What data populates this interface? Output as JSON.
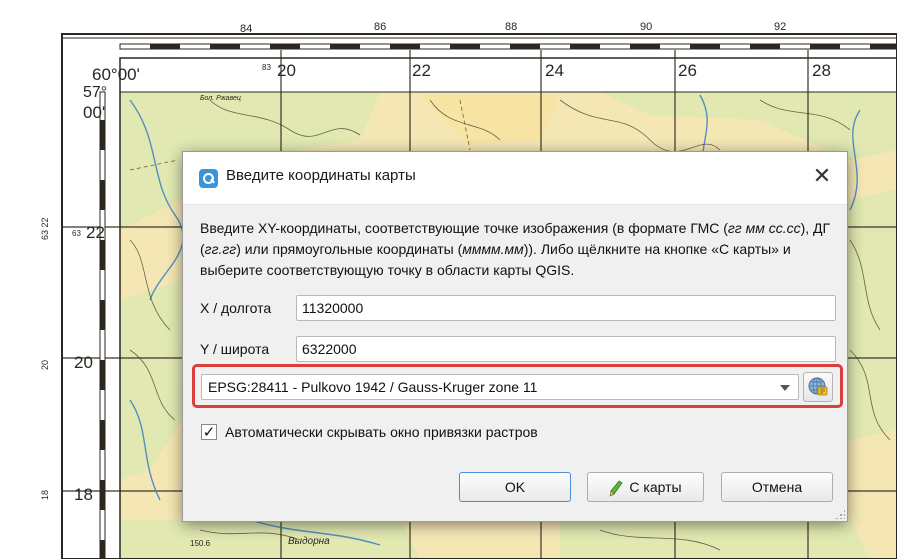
{
  "map": {
    "top_ticks": [
      "84",
      "86",
      "88",
      "90",
      "92"
    ],
    "inner_ticks": [
      "20",
      "22",
      "24",
      "26",
      "28"
    ],
    "corner_lon": "60°00'",
    "corner_lat_deg": "57°",
    "corner_lat_min": "00'",
    "small_prefix_top": "83",
    "small_prefix_left": "63",
    "left_side_label": "63 22",
    "left_marks": [
      "22",
      "20",
      "18"
    ],
    "left_margin_marks": [
      "20",
      "18"
    ],
    "place_label": "Бол. Ржавец",
    "bottom_place": "Выдорна",
    "bottom_number": "150.6"
  },
  "dialog": {
    "title": "Введите координаты карты",
    "description": {
      "p1": "Введите XY-координаты, соответствующие точке изображения (в формате ГМС (",
      "i1": "гг мм сс.сс",
      "p2": "), ДГ (",
      "i2": "гг.гг",
      "p3": ") или прямоугольные координаты (",
      "i3": "мммм.мм",
      "p4": ")). Либо щёлкните на кнопке «С карты» и выберите соответствующую точку в области карты QGIS."
    },
    "x_label": "X / долгота",
    "x_value": "11320000",
    "y_label": "Y / широта",
    "y_value": "6322000",
    "crs_value": "EPSG:28411 - Pulkovo 1942 / Gauss-Kruger zone 11",
    "auto_hide_label": "Автоматически скрывать окно привязки растров",
    "auto_hide_checked": true,
    "check_mark": "✓",
    "ok_label": "OK",
    "from_map_label": "С карты",
    "cancel_label": "Отмена",
    "close_glyph": "✕",
    "icons": {
      "app": "qgis-icon",
      "crs_selector": "globe-crs-icon",
      "from_map": "pencil-icon"
    },
    "colors": {
      "highlight": "#d9403c",
      "app_icon": "#3a94d6",
      "map_bg": "#f4e7b4",
      "map_lines": "#2f2a20"
    }
  }
}
